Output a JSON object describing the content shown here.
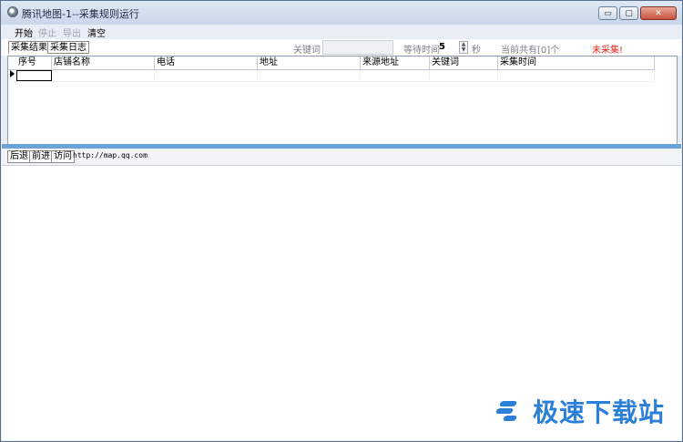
{
  "window": {
    "title": "腾讯地图-1--采集规则运行",
    "controls": {
      "minimize": "▭",
      "maximize": "▢",
      "close": "✕"
    }
  },
  "menu": {
    "items": [
      {
        "label": "开始",
        "enabled": true
      },
      {
        "label": "停止",
        "enabled": false
      },
      {
        "label": "导出",
        "enabled": false
      },
      {
        "label": "清空",
        "enabled": true
      }
    ]
  },
  "toolbar": {
    "tabs": [
      "采集结果",
      "采集日志"
    ],
    "keyword_label": "关键词",
    "keyword_value": "",
    "wait_label": "等待时间",
    "wait_value": "5",
    "wait_unit": "秒",
    "count_text": "当前共有[0]个",
    "status_text": "未采集!"
  },
  "grid": {
    "columns": [
      "序号",
      "店铺名称",
      "电话",
      "地址",
      "来源地址",
      "关键词",
      "采集时间"
    ]
  },
  "browser": {
    "back_label": "后退",
    "forward_label": "前进",
    "visit_label": "访问",
    "url": "http://map.qq.com"
  },
  "watermark": {
    "text": "极速下载站"
  },
  "colors": {
    "accent": "#2b7fd6",
    "status": "#e2231a",
    "divider": "#6aa3d8"
  }
}
